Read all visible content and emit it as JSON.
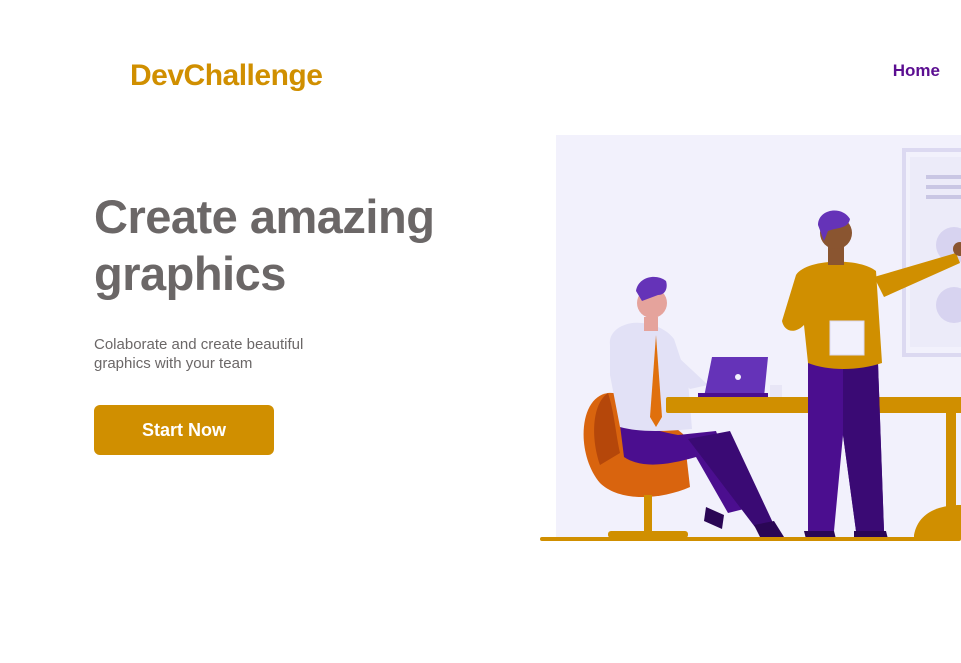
{
  "brand": {
    "name": "DevChallenge"
  },
  "nav": {
    "home_label": "Home"
  },
  "hero": {
    "headline": "Create amazing graphics",
    "subtitle": "Colaborate and create beautiful graphics with your team",
    "cta_label": "Start Now"
  },
  "colors": {
    "accent": "#D08F00",
    "nav_purple": "#5B0E91",
    "headline_gray": "#6B6767",
    "subtitle_gray": "#6B6767",
    "illustration_bg": "#F2F1FC"
  }
}
